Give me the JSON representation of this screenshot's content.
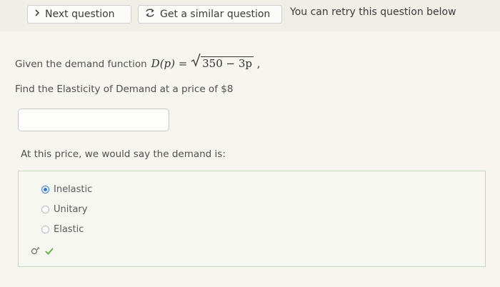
{
  "toolbar": {
    "next_label": "Next question",
    "similar_label": "Get a similar question",
    "retry_text": "You can retry this question below"
  },
  "question": {
    "intro": "Given the demand function",
    "function_lhs": "D(p) =",
    "radicand": "350 − 3p",
    "trailing": ",",
    "prompt": "Find the Elasticity of Demand at a price of $8",
    "answer_value": "",
    "demand_prompt": "At this price, we would say the demand is:"
  },
  "choices": [
    {
      "label": "Inelastic",
      "selected": true
    },
    {
      "label": "Unitary",
      "selected": false
    },
    {
      "label": "Elastic",
      "selected": false
    }
  ],
  "colors": {
    "accent": "#2e79d6",
    "check": "#5fae3c"
  }
}
